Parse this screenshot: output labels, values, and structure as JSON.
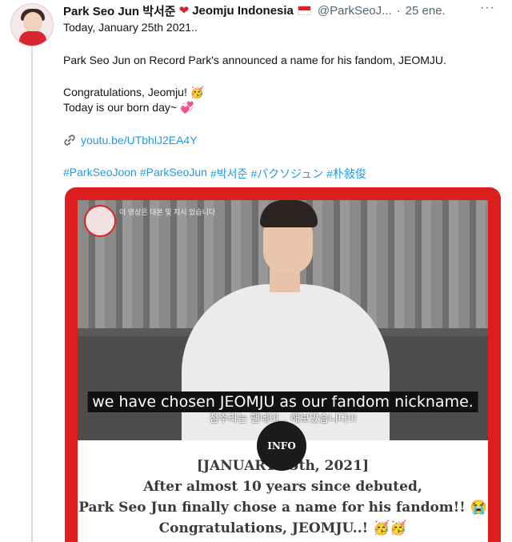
{
  "tweet": {
    "display_name": "Park Seo Jun 박서준",
    "name_suffix": "Jeomju Indonesia",
    "handle": "@ParkSeoJ...",
    "separator": "·",
    "time": "25 ene.",
    "more": "···",
    "heart_icon": "red-heart-emoji",
    "flag_icon": "indonesia-flag-emoji",
    "lines": [
      "Today, January 25th 2021..",
      "Park Seo Jun on Record Park's announced a name for his fandom, JEOMJU.",
      "Congratulations, Jeomju!",
      "Today is our born day~"
    ],
    "emoji_party": "🥳",
    "emoji_hearts": "💞",
    "link": "youtu.be/UTbhlJ2EA4Y",
    "hashtags": [
      "#ParkSeoJoon",
      "#ParkSeoJun",
      "#박서준",
      "#パクソジュン",
      "#朴敍俊"
    ]
  },
  "media": {
    "channel_text": "이 영상은 대본 및 지시 있습니다",
    "caption": "we have chosen JEOMJU as our fandom nickname.",
    "subcaption": "점주라는 팬네이... 해보았습니다!!!",
    "badge": "INFO",
    "info_lines": [
      "[JANUARY 25th, 2021]",
      "After almost 10 years since debuted,",
      "Park Seo Jun finally chose a name for his fandom!! 😭",
      "Congratulations, JEOMJU..! 🥳🥳"
    ],
    "accent_color": "#dd1e1e"
  }
}
